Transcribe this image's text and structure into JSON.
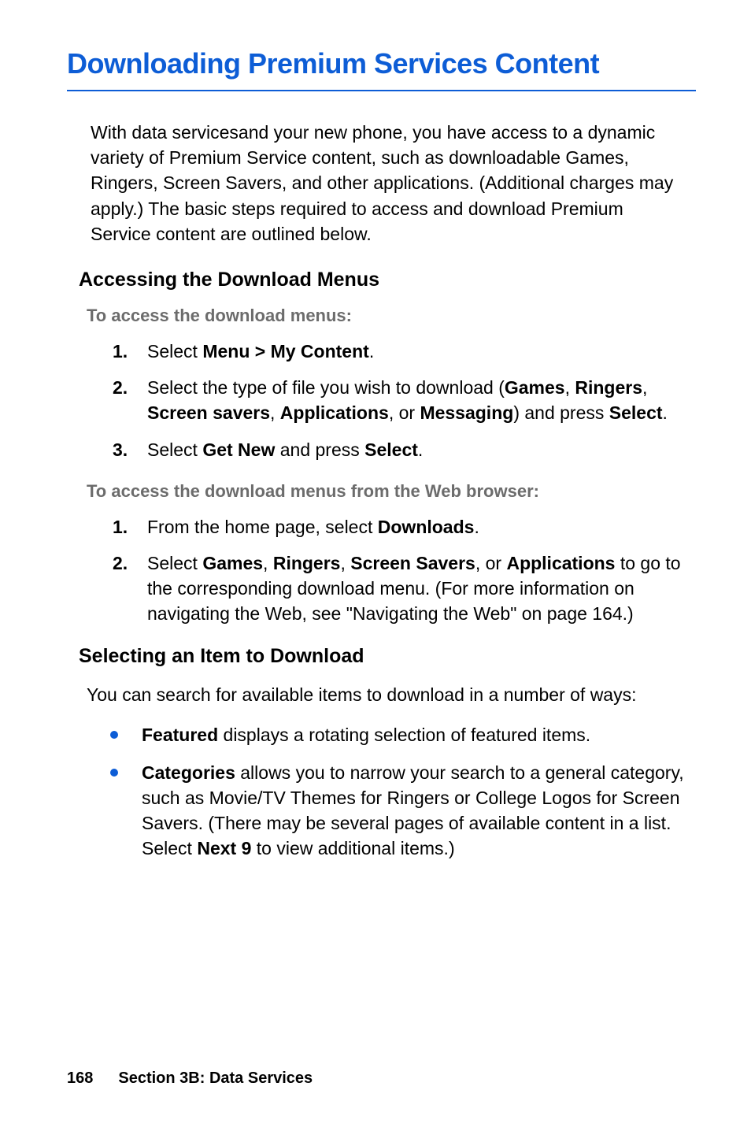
{
  "title": "Downloading Premium Services Content",
  "intro": "With data servicesand your new phone, you have access to a dynamic variety of Premium Service content, such as downloadable Games, Ringers, Screen Savers, and other applications. (Additional charges may apply.) The basic steps required to access and download Premium Service content are outlined below.",
  "section1": {
    "heading": "Accessing the Download Menus",
    "instr1": "To access the download menus:",
    "list1": {
      "n1": "1.",
      "i1a": "Select ",
      "i1b": "Menu > My Content",
      "i1c": ".",
      "n2": "2.",
      "i2a": "Select the type of file you wish to download (",
      "i2b": "Games",
      "i2c": ", ",
      "i2d": "Ringers",
      "i2e": ", ",
      "i2f": "Screen savers",
      "i2g": ", ",
      "i2h": "Applications",
      "i2i": ", or ",
      "i2j": "Messaging",
      "i2k": ") and press ",
      "i2l": "Select",
      "i2m": ".",
      "n3": "3.",
      "i3a": "Select ",
      "i3b": "Get New",
      "i3c": " and press ",
      "i3d": "Select",
      "i3e": "."
    },
    "instr2": "To access the download menus from the Web browser:",
    "list2": {
      "n1": "1.",
      "i1a": "From the home page, select ",
      "i1b": "Downloads",
      "i1c": ".",
      "n2": "2.",
      "i2a": "Select ",
      "i2b": "Games",
      "i2c": ", ",
      "i2d": "Ringers",
      "i2e": ", ",
      "i2f": "Screen Savers",
      "i2g": ", or ",
      "i2h": "Applications",
      "i2i": " to go to the corresponding download menu. (For more information on navigating the Web, see \"Navigating the Web\" on page 164.)"
    }
  },
  "section2": {
    "heading": "Selecting an Item to Download",
    "para": "You can search for available items to download in a number of ways:",
    "bullets": {
      "b1a": "Featured",
      "b1b": " displays a rotating selection of featured items.",
      "b2a": "Categories",
      "b2b": " allows you to narrow your search to a general category, such as Movie/TV Themes for Ringers or College Logos for Screen Savers. (There may be several pages of available content in a list. Select ",
      "b2c": "Next 9",
      "b2d": " to view additional items.)"
    }
  },
  "footer": {
    "pagenum": "168",
    "section": "Section 3B: Data Services"
  }
}
